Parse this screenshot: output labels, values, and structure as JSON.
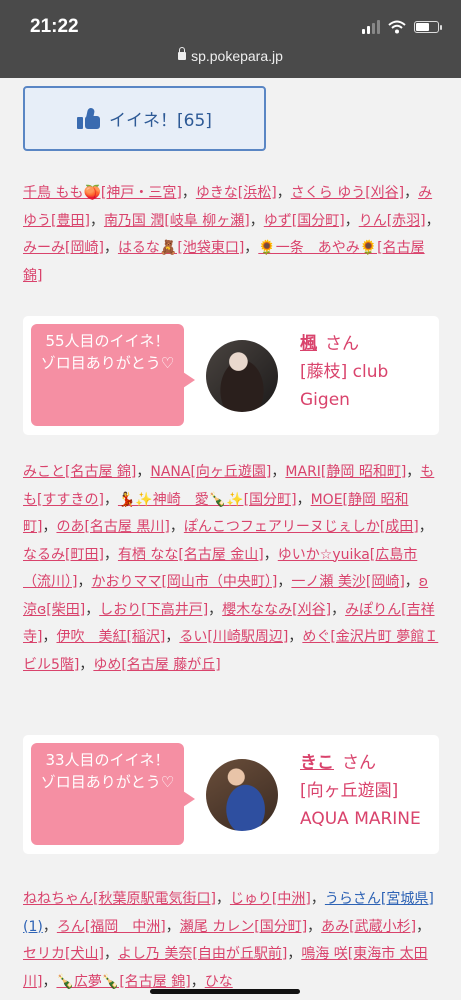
{
  "status": {
    "time": "21:22",
    "url": "sp.pokepara.jp"
  },
  "like_button": {
    "label": "イイネ！[65]",
    "icon": "thumbs-up-icon",
    "color": "#3a6bb0"
  },
  "names1": [
    {
      "t": "千鳥 もも🍑[神戸・三宮]",
      "link": true
    },
    {
      "t": "，",
      "link": false
    },
    {
      "t": "ゆきな[浜松]",
      "link": true
    },
    {
      "t": "，",
      "link": false
    },
    {
      "t": "さくら ゆう[刈谷]",
      "link": true
    },
    {
      "t": "，",
      "link": false
    },
    {
      "t": "みゆう[豊田]",
      "link": true
    },
    {
      "t": "，",
      "link": false
    },
    {
      "t": "南乃国 潤[岐阜 柳ヶ瀬]",
      "link": true
    },
    {
      "t": "，",
      "link": false
    },
    {
      "t": "ゆず[国分町]",
      "link": true
    },
    {
      "t": "，",
      "link": false
    },
    {
      "t": "りん[赤羽]",
      "link": true
    },
    {
      "t": "，",
      "link": false
    },
    {
      "t": "みーみ[岡崎]",
      "link": true
    },
    {
      "t": "，",
      "link": false
    },
    {
      "t": "はるな🧸[池袋東口]",
      "link": true
    },
    {
      "t": "，",
      "link": false
    },
    {
      "t": "🌻一条　あやみ🌻[名古屋 錦]",
      "link": true
    }
  ],
  "card1": {
    "bubble": "55人目のイイネ！\nゾロ目ありがとう♡",
    "name": "楓",
    "san": "さん",
    "place": "[藤枝] club Gigen"
  },
  "names2": [
    {
      "t": "みこと[名古屋 錦]",
      "link": true
    },
    {
      "t": "，",
      "link": false
    },
    {
      "t": "NANA[向ヶ丘遊園]",
      "link": true
    },
    {
      "t": "，",
      "link": false
    },
    {
      "t": "MARI[静岡 昭和町]",
      "link": true
    },
    {
      "t": "，",
      "link": false
    },
    {
      "t": "もも[すすきの]",
      "link": true
    },
    {
      "t": "，",
      "link": false
    },
    {
      "t": "💃✨神崎　愛🍾✨[国分町]",
      "link": true
    },
    {
      "t": "，",
      "link": false
    },
    {
      "t": "MOE[静岡 昭和町]",
      "link": true
    },
    {
      "t": "，",
      "link": false
    },
    {
      "t": "のあ[名古屋 黒川]",
      "link": true
    },
    {
      "t": "，",
      "link": false
    },
    {
      "t": "ぽんこつフェアリーヌじぇしか[成田]",
      "link": true
    },
    {
      "t": "，",
      "link": false
    },
    {
      "t": "なるみ[町田]",
      "link": true
    },
    {
      "t": "，",
      "link": false
    },
    {
      "t": "有栖 なな[名古屋 金山]",
      "link": true
    },
    {
      "t": "，",
      "link": false
    },
    {
      "t": "ゆいか☆yuika[広島市（流川）]",
      "link": true
    },
    {
      "t": "，",
      "link": false
    },
    {
      "t": "かおりママ[岡山市（中央町）]",
      "link": true
    },
    {
      "t": "，",
      "link": false
    },
    {
      "t": "一ノ瀬 美沙[岡崎]",
      "link": true
    },
    {
      "t": "，",
      "link": false
    },
    {
      "t": "ʚ涼ɞ[柴田]",
      "link": true
    },
    {
      "t": "，",
      "link": false
    },
    {
      "t": "しおり[下高井戸]",
      "link": true
    },
    {
      "t": "，",
      "link": false
    },
    {
      "t": "櫻木ななみ[刈谷]",
      "link": true
    },
    {
      "t": "，",
      "link": false
    },
    {
      "t": "みぽりん[吉祥寺]",
      "link": true
    },
    {
      "t": "，",
      "link": false
    },
    {
      "t": "伊吹　美紅[稲沢]",
      "link": true
    },
    {
      "t": "，",
      "link": false
    },
    {
      "t": "るい[川崎駅周辺]",
      "link": true
    },
    {
      "t": "，",
      "link": false
    },
    {
      "t": "めぐ[金沢片町 夢館Ｉビル5階]",
      "link": true
    },
    {
      "t": "，",
      "link": false
    },
    {
      "t": "ゆめ[名古屋 藤が丘]",
      "link": true
    }
  ],
  "card2": {
    "bubble": "33人目のイイネ！\nゾロ目ありがとう♡",
    "name": "きこ",
    "san": "さん",
    "place": "[向ヶ丘遊園] AQUA MARINE"
  },
  "names3": [
    {
      "t": "ねねちゃん[秋葉原駅電気街口]",
      "link": true
    },
    {
      "t": "，",
      "link": false
    },
    {
      "t": "じゅり[中洲]",
      "link": true
    },
    {
      "t": "，",
      "link": false
    },
    {
      "t": "うらさん[宮城県](1)",
      "link": true,
      "blue": true
    },
    {
      "t": "，",
      "link": false
    },
    {
      "t": "ろん[福岡　中洲]",
      "link": true
    },
    {
      "t": "，",
      "link": false
    },
    {
      "t": "瀬尾 カレン[国分町]",
      "link": true
    },
    {
      "t": "，",
      "link": false
    },
    {
      "t": "あみ[武蔵小杉]",
      "link": true
    },
    {
      "t": "，",
      "link": false
    },
    {
      "t": "セリカ[犬山]",
      "link": true
    },
    {
      "t": "，",
      "link": false
    },
    {
      "t": "よし乃 美奈[自由が丘駅前]",
      "link": true
    },
    {
      "t": "，",
      "link": false
    },
    {
      "t": "鳴海 咲[東海市 太田川]",
      "link": true
    },
    {
      "t": "，",
      "link": false
    },
    {
      "t": "🍾広夢🍾[名古屋 錦]",
      "link": true
    },
    {
      "t": "，",
      "link": false
    },
    {
      "t": "ひな",
      "link": true
    }
  ]
}
